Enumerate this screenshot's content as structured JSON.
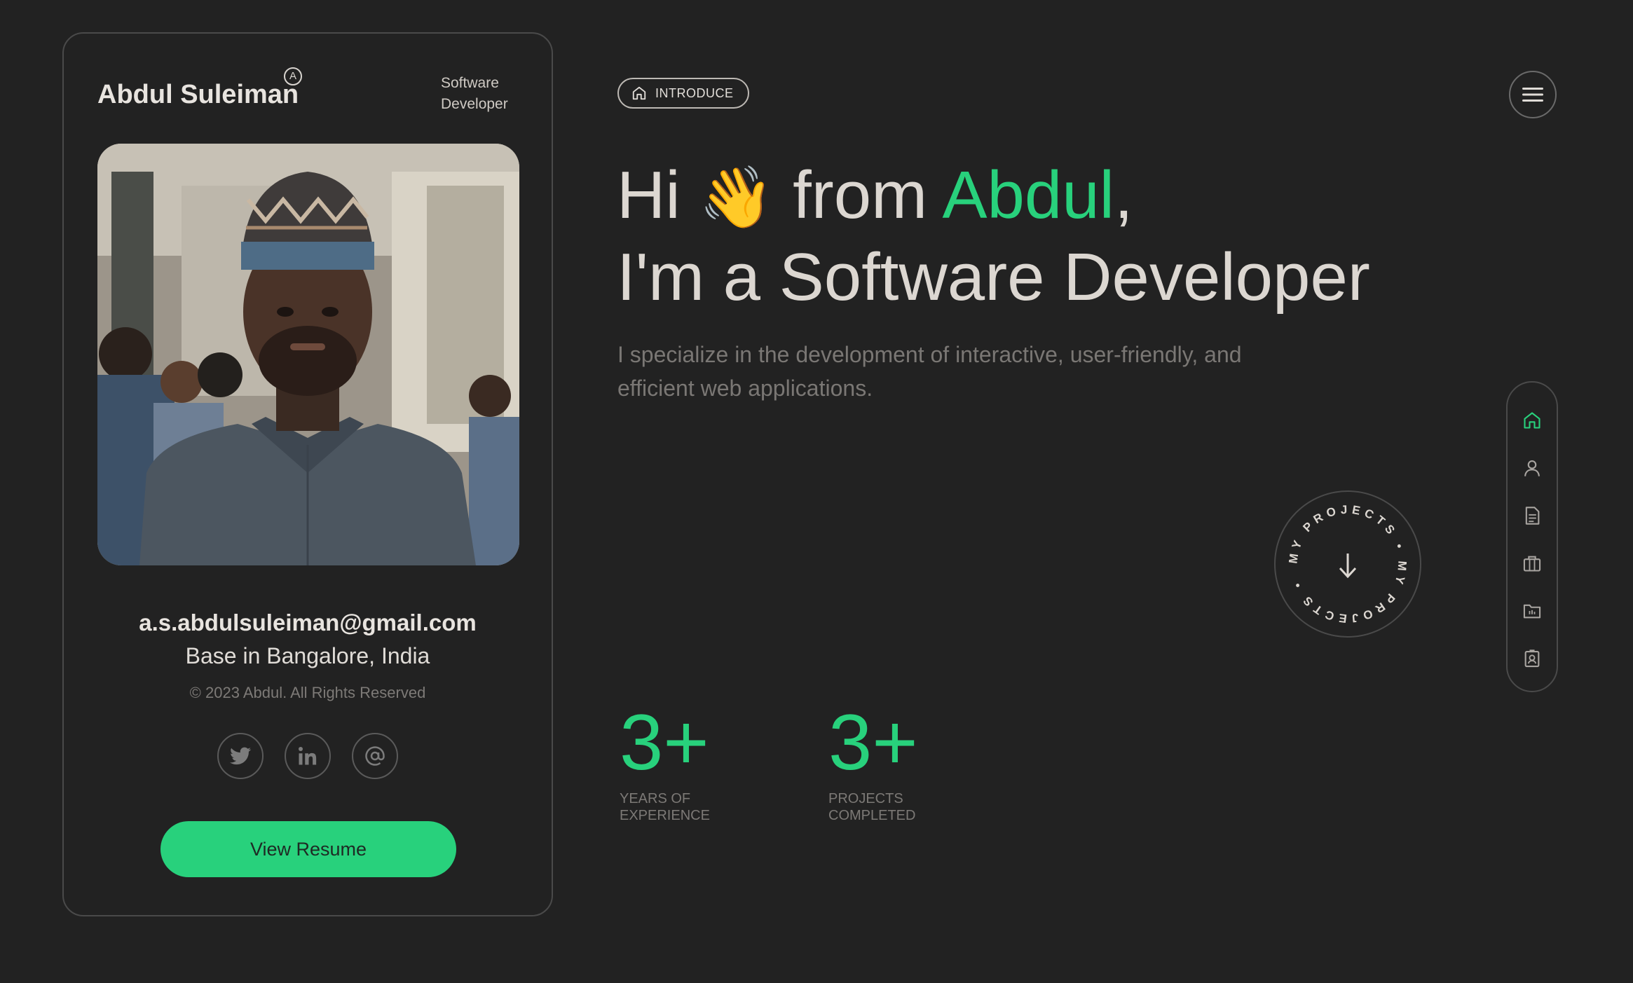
{
  "profile": {
    "name": "Abdul Suleiman",
    "logo_mark": "A",
    "role": "Software Developer",
    "photo_alt": "profile-photo",
    "email": "a.s.abdulsuleiman@gmail.com",
    "location": "Base in Bangalore, India",
    "copyright": "© 2023 Abdul. All Rights Reserved",
    "socials": [
      {
        "icon": "twitter-icon"
      },
      {
        "icon": "linkedin-icon"
      },
      {
        "icon": "at-icon"
      }
    ],
    "resume_label": "View Resume"
  },
  "intro": {
    "badge": "INTRODUCE",
    "hero_line1_a": "Hi ",
    "hero_emoji": "👋",
    "hero_line1_b": " from ",
    "hero_name": "Abdul",
    "hero_comma": ",",
    "hero_line2": "I'm a Software Developer",
    "subtitle": "I specialize in the development of interactive, user-friendly, and efficient web applications."
  },
  "stats": [
    {
      "value": "3+",
      "label_1": "YEARS OF",
      "label_2": "EXPERIENCE"
    },
    {
      "value": "3+",
      "label_1": "PROJECTS",
      "label_2": "COMPLETED"
    }
  ],
  "projects_badge": {
    "circular_text": "MY PROJECTS • MY PROJECTS •"
  },
  "side_nav": {
    "items": [
      {
        "icon": "home-icon",
        "active": true
      },
      {
        "icon": "user-icon",
        "active": false
      },
      {
        "icon": "document-icon",
        "active": false
      },
      {
        "icon": "briefcase-icon",
        "active": false
      },
      {
        "icon": "folder-icon",
        "active": false
      },
      {
        "icon": "contact-icon",
        "active": false
      }
    ]
  },
  "colors": {
    "background": "#222222",
    "accent": "#28d17c",
    "text": "#dcd7d1",
    "muted": "#7a7774",
    "border": "#4a4a4a"
  }
}
